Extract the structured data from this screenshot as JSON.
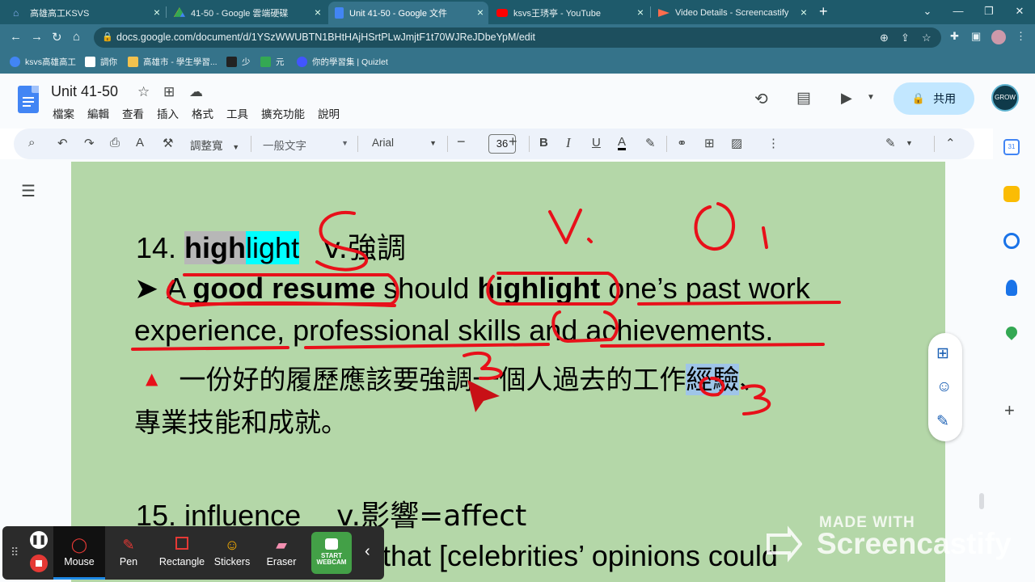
{
  "browser": {
    "tabs": [
      {
        "title": "高雄高工KSVS",
        "color": "#8ab4f8"
      },
      {
        "title": "41-50 - Google 雲端硬碟",
        "color": "#34a853"
      },
      {
        "title": "Unit 41-50 - Google 文件",
        "color": "#4285f4"
      },
      {
        "title": "ksvs王琇亭 - YouTube",
        "color": "#ff0000"
      },
      {
        "title": "Video Details - Screencastify",
        "color": "#ff6d4d"
      }
    ],
    "url": "docs.google.com/document/d/1YSzWWUBTN1BHtHAjHSrtPLwJmjtF1t70WJReJDbeYpM/edit",
    "bookmarks": [
      {
        "label": "ksvs高雄高工"
      },
      {
        "label": "調你"
      },
      {
        "label": "高雄市 - 學生學習..."
      },
      {
        "label": "少"
      },
      {
        "label": "元"
      },
      {
        "label": "你的學習集 | Quizlet"
      }
    ]
  },
  "docs": {
    "title": "Unit 41-50",
    "menus": [
      "檔案",
      "編輯",
      "查看",
      "插入",
      "格式",
      "工具",
      "擴充功能",
      "說明"
    ],
    "share_label": "共用",
    "avatar_text": "GROW",
    "toolbar": {
      "zoom": "調整寬",
      "style": "一般文字",
      "font": "Arial",
      "font_size": "36"
    }
  },
  "content": {
    "line1_num": "14. ",
    "line1_high": "high",
    "line1_light": "light",
    "line1_pos": "v.強調",
    "line2_bullet": "➤",
    "line2_a": "A ",
    "line2_good": "good resume",
    "line2_should": " should ",
    "line2_highlight": "highlight",
    "line2_rest": " one’s past work",
    "line3": "experience, professional skills and achievements.",
    "line4_marker": "▲",
    "line4_text_a": "一份好的履歷應該要強調一個人過去的工作",
    "line4_text_hl": "經驗",
    "line4_text_b": "、",
    "line5": "專業技能和成就。",
    "line6_num": "15. influence",
    "line6_pos": "v.影響=affect",
    "line7": "that [celebrities’ opinions could"
  },
  "screencastify": {
    "buttons": [
      "Mouse",
      "Pen",
      "Rectangle",
      "Stickers",
      "Eraser"
    ],
    "webcam_label_1": "START",
    "webcam_label_2": "WEBCAM",
    "watermark_small": "MADE WITH",
    "watermark_big": "Screencastify"
  },
  "colors": {
    "page_bg": "#b4d7a8",
    "annotation_red": "#e8101a",
    "highlight_gray": "#b7b7b7",
    "highlight_cyan": "#00ffff",
    "highlight_blue": "#9fc5e8"
  }
}
